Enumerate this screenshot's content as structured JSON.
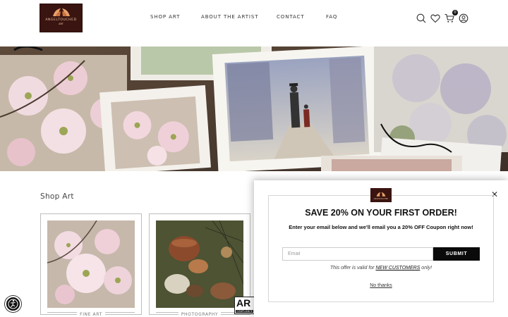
{
  "brand": {
    "logo_text": "ANGELTOUCHED",
    "logo_sub": "ART"
  },
  "nav": {
    "items": [
      {
        "label": "SHOP ART"
      },
      {
        "label": "ABOUT THE ARTIST"
      },
      {
        "label": "CONTACT"
      },
      {
        "label": "FAQ"
      }
    ]
  },
  "header_icons": {
    "search": "search-icon",
    "wishlist": "heart-icon",
    "cart": "cart-icon",
    "cart_count": "0",
    "account": "account-icon"
  },
  "shop": {
    "title": "Shop Art",
    "categories": [
      {
        "label": "FINE ART"
      },
      {
        "label": "PHOTOGRAPHY"
      }
    ]
  },
  "badges": {
    "accessibility": "accessibility-icon",
    "ar_text": "AR",
    "ar_sub": "COMPLIANCE"
  },
  "popup": {
    "heading": "SAVE 20% ON YOUR FIRST ORDER!",
    "body": "Enter your email below and we'll email you a 20% OFF Coupon right now!",
    "email_placeholder": "Email",
    "submit_label": "SUBMIT",
    "note_prefix": "This offer is valid for ",
    "note_highlight": "NEW CUSTOMERS",
    "note_suffix": " only!",
    "decline_label": "No thanks",
    "close_symbol": "✕"
  },
  "colors": {
    "logo_bg": "#3a1410",
    "logo_accent": "#e8a06a",
    "button_bg": "#0a0a0a"
  }
}
